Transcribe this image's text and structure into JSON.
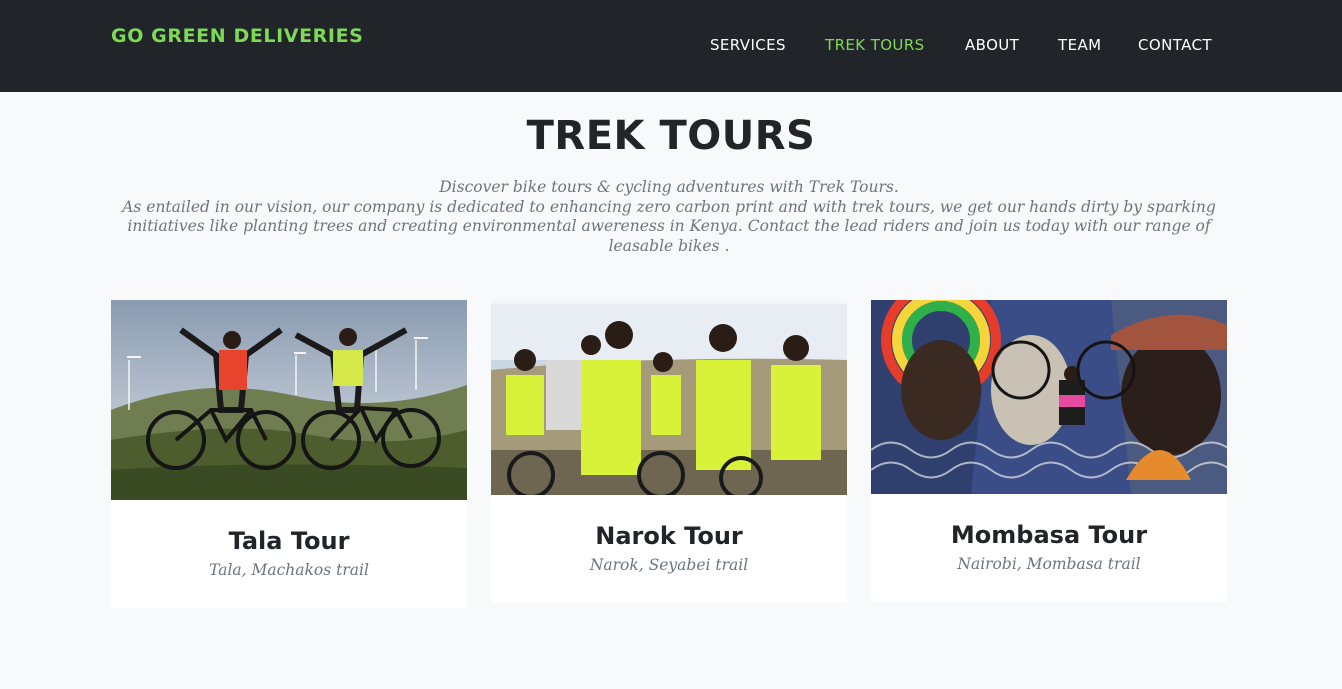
{
  "navbar": {
    "brand": "GO GREEN DELIVERIES",
    "links": [
      {
        "label": "SERVICES",
        "active": false
      },
      {
        "label": "TREK TOURS",
        "active": true
      },
      {
        "label": "ABOUT",
        "active": false
      },
      {
        "label": "TEAM",
        "active": false
      },
      {
        "label": "CONTACT",
        "active": false
      }
    ]
  },
  "section": {
    "heading": "TREK TOURS",
    "intro_line1": "Discover bike tours & cycling adventures with Trek Tours.",
    "intro_line2": "As entailed in our vision, our company is dedicated to enhancing zero carbon print and with trek tours, we get our hands dirty by sparking initiatives like planting trees and creating environmental awereness in Kenya. Contact the lead riders and join us today with our range of leasable bikes ."
  },
  "tours": [
    {
      "title": "Tala Tour",
      "subtitle": "Tala, Machakos trail",
      "photo_icon": "cyclists-hilltop-photo"
    },
    {
      "title": "Narok Tour",
      "subtitle": "Narok, Seyabei trail",
      "photo_icon": "cyclists-group-photo"
    },
    {
      "title": "Mombasa Tour",
      "subtitle": "Nairobi, Mombasa trail",
      "photo_icon": "cyclist-mural-photo"
    }
  ],
  "colors": {
    "navbar_bg": "#212529",
    "accent_green": "#7ed957",
    "page_bg": "#f8f9fa",
    "muted_text": "#6c757d"
  }
}
